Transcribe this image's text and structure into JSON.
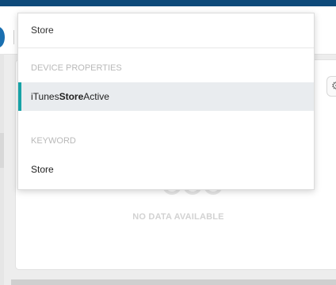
{
  "search": {
    "value": "Store"
  },
  "dropdown": {
    "device_properties_title": "DEVICE PROPERTIES",
    "device_item_prefix": "iTunes ",
    "device_item_highlight": "Store",
    "device_item_suffix": " Active",
    "keyword_title": "KEYWORD",
    "keyword_item": "Store"
  },
  "card": {
    "empty_text": "NO DATA AVAILABLE"
  },
  "colors": {
    "topbar": "#0e4a7a",
    "accent": "#17a2a6",
    "selected_bg": "#e9ecef"
  },
  "icons": {
    "settings": "settings-gear-icon",
    "empty_state": "empty-circles-icon"
  }
}
